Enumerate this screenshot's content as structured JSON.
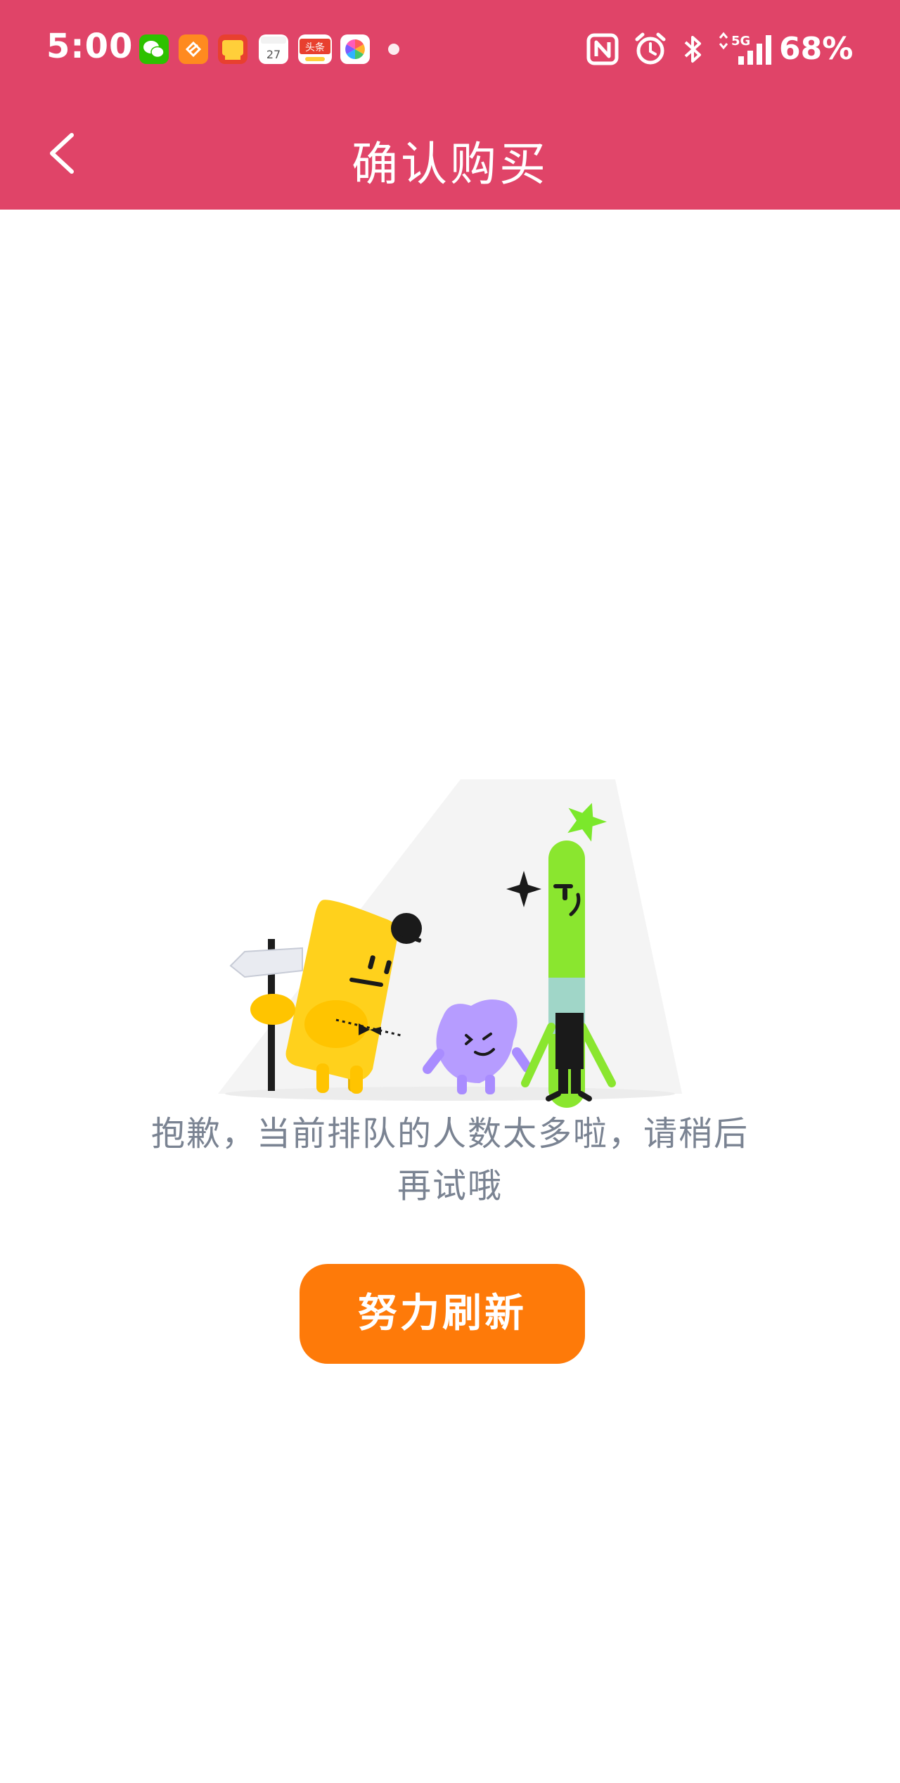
{
  "status_bar": {
    "time": "5:00",
    "battery": "68%",
    "network": "5G",
    "app_icons": [
      "wechat-icon",
      "heart-app-icon",
      "promo-app-icon",
      "calendar-icon",
      "toutiao-icon",
      "photos-app-icon"
    ],
    "calendar_day": "27",
    "toutiao_label": "头条",
    "system_icons": [
      "nfc-icon",
      "alarm-icon",
      "bluetooth-icon",
      "signal-icon"
    ]
  },
  "nav": {
    "title": "确认购买",
    "back_icon": "chevron-left-icon"
  },
  "colors": {
    "header": "#e04468",
    "button": "#fe7a09",
    "message_text": "#7a8392",
    "background": "#ffffff"
  },
  "empty_state": {
    "illustration": "queue-characters-illustration",
    "message_line1": "抱歉，当前排队的人数太多啦，请稍后",
    "message_line2": "再试哦",
    "button_label": "努力刷新"
  }
}
